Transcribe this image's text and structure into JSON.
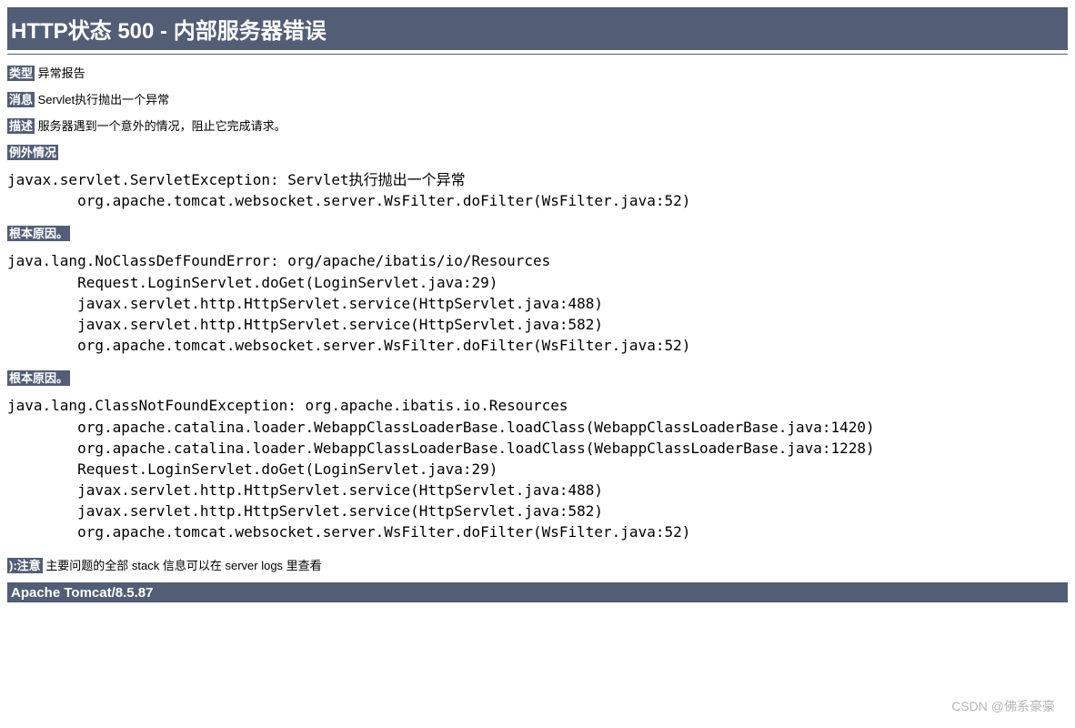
{
  "title": "HTTP状态 500 - 内部服务器错误",
  "type": {
    "label": "类型",
    "value": "异常报告"
  },
  "message": {
    "label": "消息",
    "value": "Servlet执行抛出一个异常"
  },
  "description": {
    "label": "描述",
    "value": "服务器遇到一个意外的情况，阻止它完成请求。"
  },
  "exception": {
    "label": "例外情况",
    "trace": "javax.servlet.ServletException: Servlet执行抛出一个异常\n        org.apache.tomcat.websocket.server.WsFilter.doFilter(WsFilter.java:52)"
  },
  "rootCause1": {
    "label": "根本原因。",
    "trace": "java.lang.NoClassDefFoundError: org/apache/ibatis/io/Resources\n        Request.LoginServlet.doGet(LoginServlet.java:29)\n        javax.servlet.http.HttpServlet.service(HttpServlet.java:488)\n        javax.servlet.http.HttpServlet.service(HttpServlet.java:582)\n        org.apache.tomcat.websocket.server.WsFilter.doFilter(WsFilter.java:52)"
  },
  "rootCause2": {
    "label": "根本原因。",
    "trace": "java.lang.ClassNotFoundException: org.apache.ibatis.io.Resources\n        org.apache.catalina.loader.WebappClassLoaderBase.loadClass(WebappClassLoaderBase.java:1420)\n        org.apache.catalina.loader.WebappClassLoaderBase.loadClass(WebappClassLoaderBase.java:1228)\n        Request.LoginServlet.doGet(LoginServlet.java:29)\n        javax.servlet.http.HttpServlet.service(HttpServlet.java:488)\n        javax.servlet.http.HttpServlet.service(HttpServlet.java:582)\n        org.apache.tomcat.websocket.server.WsFilter.doFilter(WsFilter.java:52)"
  },
  "note": {
    "label": "):注意",
    "value": "主要问题的全部 stack 信息可以在 server logs 里查看"
  },
  "footer": "Apache Tomcat/8.5.87",
  "watermark": "CSDN @佛系豪豪"
}
